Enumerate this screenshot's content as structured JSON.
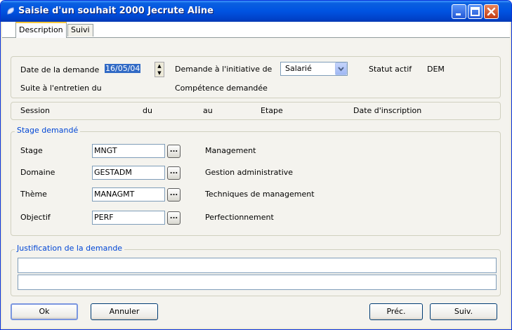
{
  "window": {
    "title": "Saisie d'un souhait 2000  Jecrute  Aline",
    "controls": {
      "minimize": "minimize",
      "maximize": "maximize",
      "close": "close"
    }
  },
  "tabs": [
    {
      "label": "Description",
      "active": true
    },
    {
      "label": "Suivi",
      "active": false
    }
  ],
  "request": {
    "date_label": "Date de la demande",
    "date_value": "16/05/04",
    "initiative_label": "Demande à l'initiative de",
    "initiative_value": "Salarié",
    "status_label": "Statut actif",
    "status_value": "DEM",
    "interview_label": "Suite à l'entretien du",
    "competence_label": "Compétence demandée"
  },
  "session_header": {
    "session": "Session",
    "from": "du",
    "to": "au",
    "step": "Etape",
    "registration_date": "Date d'inscription"
  },
  "stage_group": {
    "legend": "Stage demandé",
    "rows": [
      {
        "label": "Stage",
        "code": "MNGT",
        "description": "Management"
      },
      {
        "label": "Domaine",
        "code": "GESTADM",
        "description": "Gestion administrative"
      },
      {
        "label": "Thème",
        "code": "MANAGMT",
        "description": "Techniques de management"
      },
      {
        "label": "Objectif",
        "code": "PERF",
        "description": "Perfectionnement"
      }
    ],
    "lookup_glyph": "..."
  },
  "justification": {
    "legend": "Justification de la demande",
    "line1": "",
    "line2": ""
  },
  "buttons": {
    "ok": "Ok",
    "cancel": "Annuler",
    "previous": "Préc.",
    "next": "Suiv."
  },
  "colors": {
    "titlebar": "#0053e1",
    "legend_text": "#0046d5",
    "selection": "#316ac5",
    "active_tab_accent": "#ffc73c",
    "close_button": "#c23a12"
  },
  "icons": {
    "title": "window-app-icon",
    "spinner": "spin-arrows-icon",
    "dropdown": "chevron-down-icon",
    "lookup": "ellipsis-icon"
  }
}
